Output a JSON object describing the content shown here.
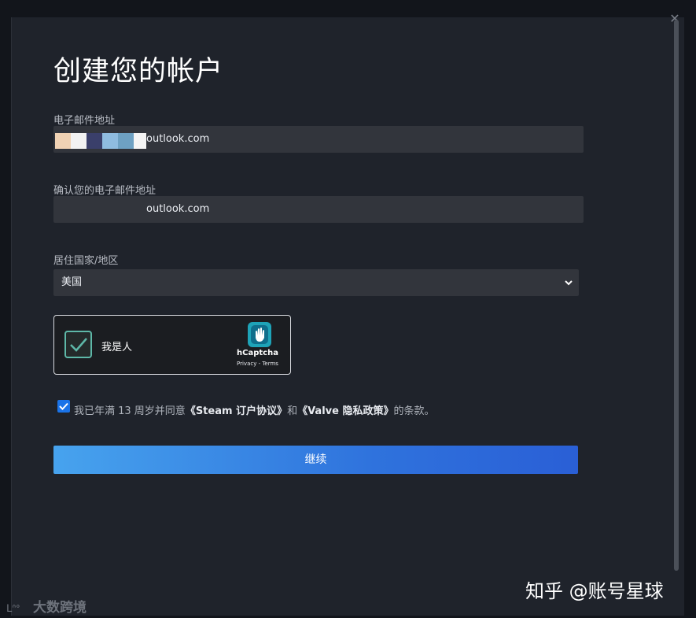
{
  "dialog": {
    "title": "创建您的帐户",
    "close_icon": "close-icon"
  },
  "form": {
    "email": {
      "label": "电子邮件地址",
      "value": "outlook.com"
    },
    "confirm_email": {
      "label": "确认您的电子邮件地址",
      "value": "outlook.com"
    },
    "country": {
      "label": "居住国家/地区",
      "selected": "美国"
    },
    "captcha": {
      "label": "我是人",
      "brand": "hCaptcha",
      "links": "Privacy - Terms",
      "checked": true
    },
    "agreement": {
      "checked": true,
      "prefix": "我已年满 13 周岁并同意",
      "steam_link": "《Steam 订户协议》",
      "middle": "和",
      "valve_link": "《Valve 隐私政策》",
      "suffix": "的条款。"
    },
    "continue_label": "继续"
  },
  "watermarks": {
    "right": "知乎 @账号星球",
    "left": "大数跨境"
  },
  "colors": {
    "dialog_bg": "#1f232b",
    "input_bg": "#32353c",
    "accent": "#2f73dd",
    "captcha_check": "#5eb8a8"
  }
}
